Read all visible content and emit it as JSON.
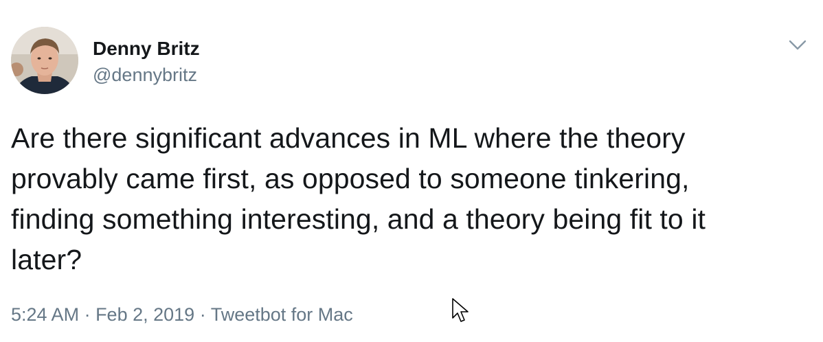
{
  "tweet": {
    "author": {
      "display_name": "Denny Britz",
      "handle": "@dennybritz"
    },
    "text_lines": [
      "Are there significant advances in ML where the theory",
      "provably came first, as opposed to someone tinkering,",
      "finding something interesting, and a theory being fit to it",
      "later?"
    ],
    "meta": {
      "time": "5:24 AM",
      "separator_1": " · ",
      "date": "Feb 2, 2019",
      "separator_2": " · ",
      "source": "Tweetbot for Mac"
    },
    "menu_icon": "chevron-down-icon"
  },
  "colors": {
    "text_primary": "#14171a",
    "text_secondary": "#657786",
    "background": "#ffffff"
  }
}
